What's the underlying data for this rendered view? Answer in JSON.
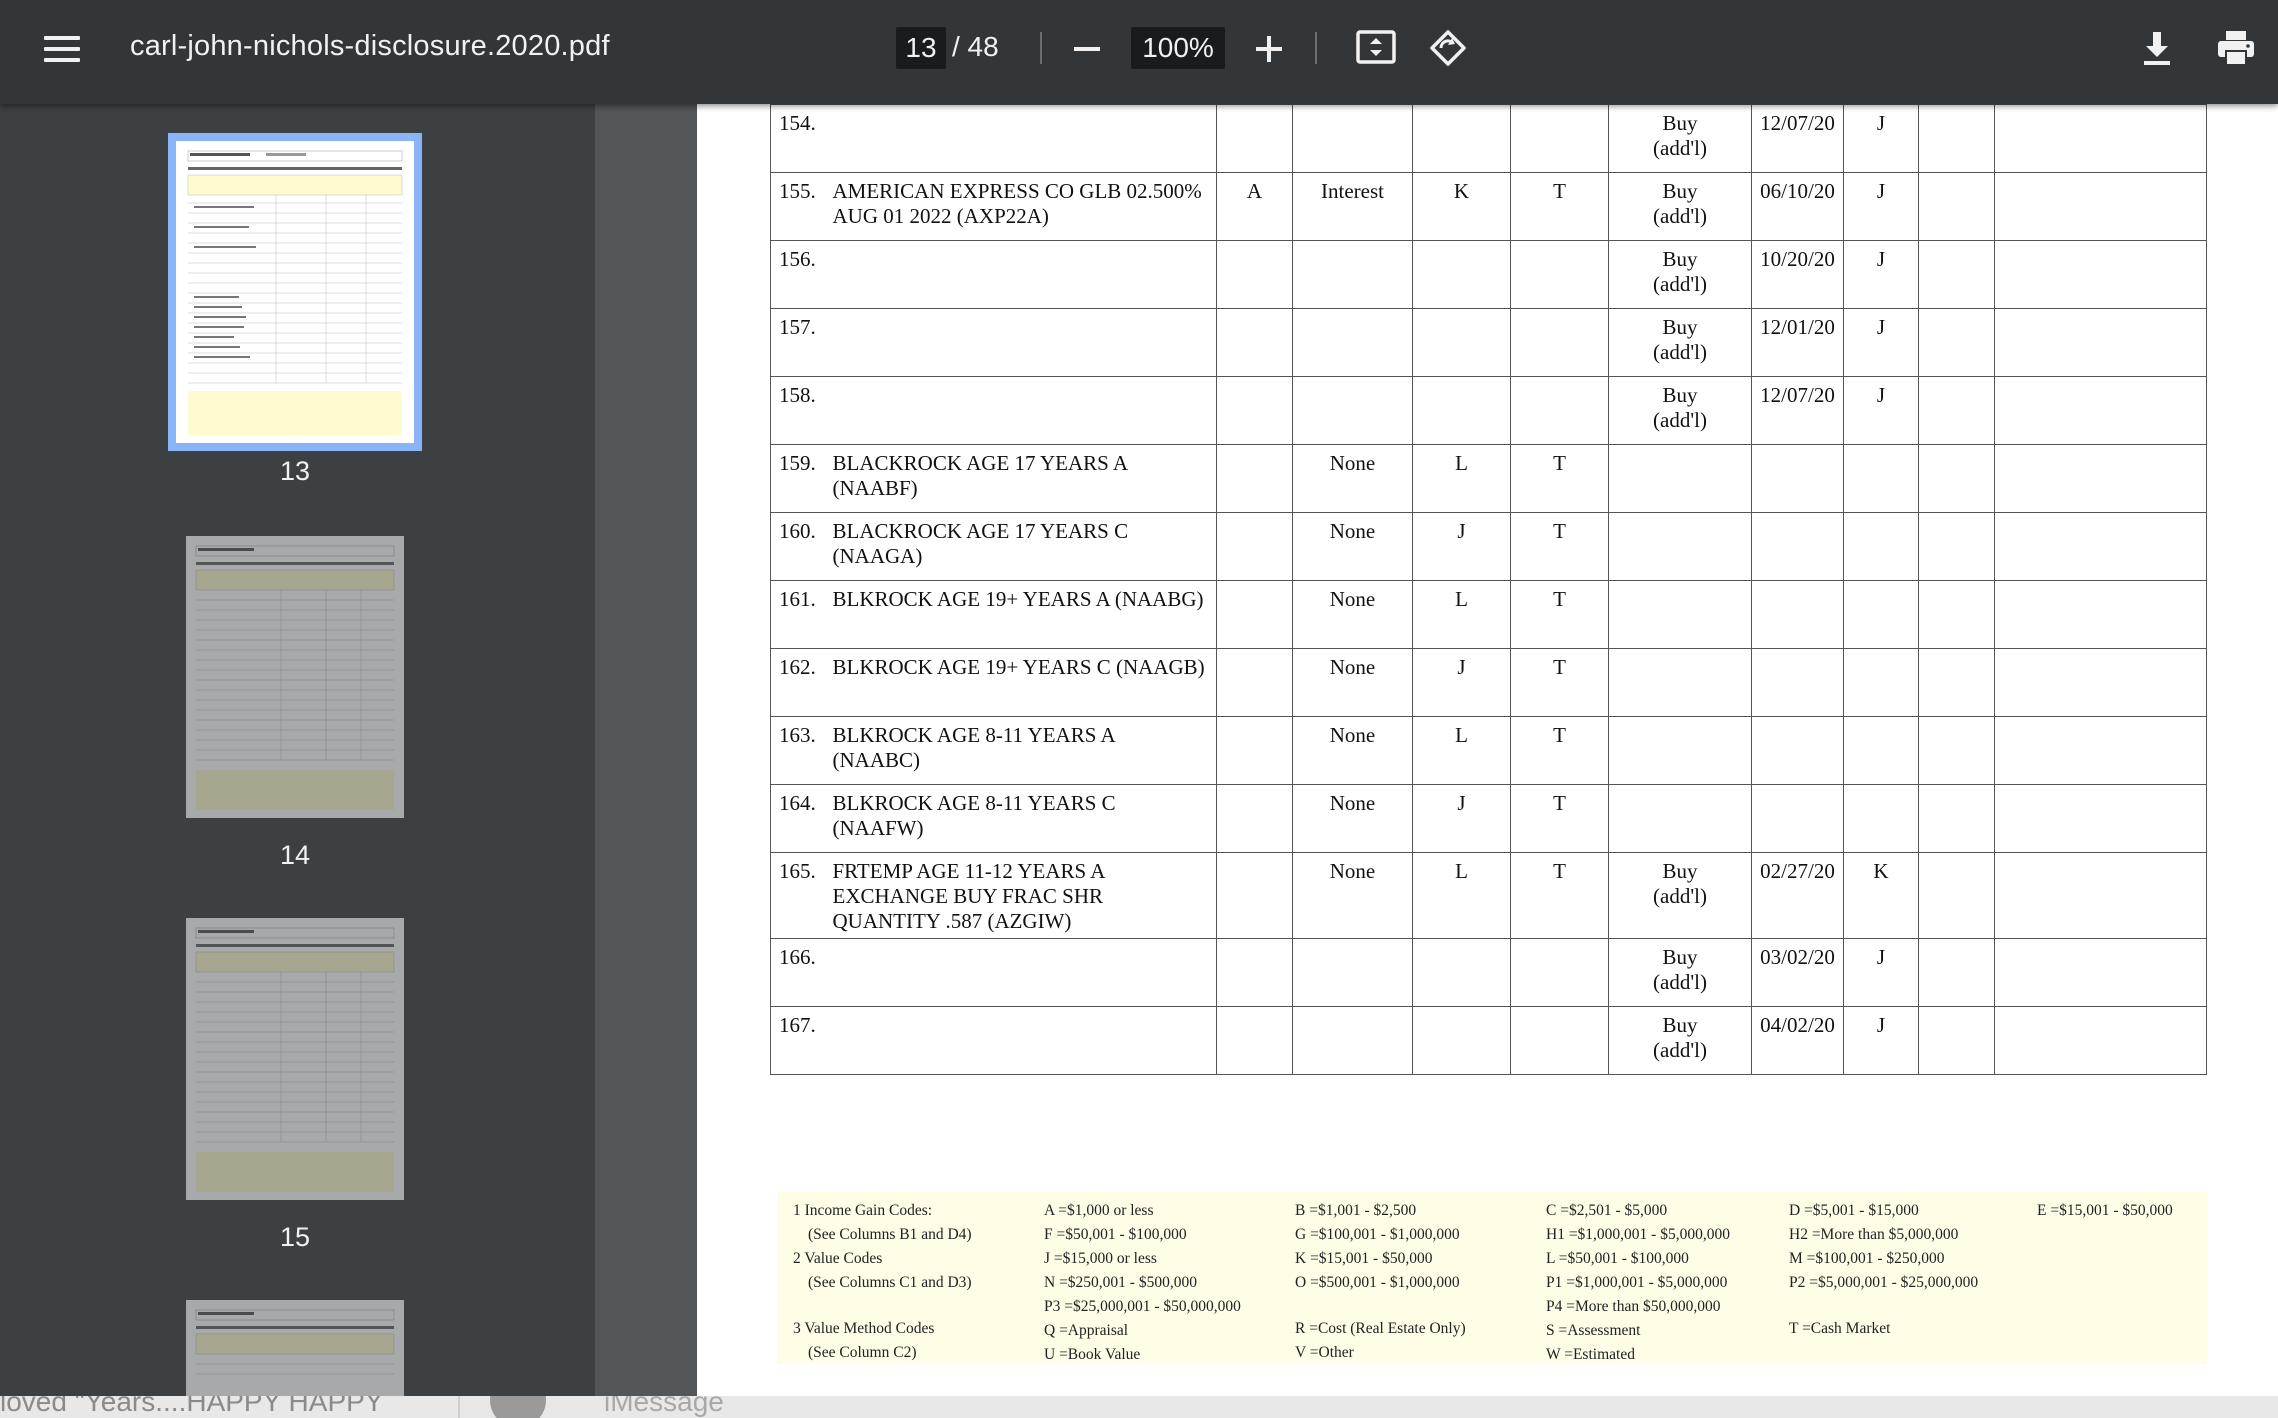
{
  "toolbar": {
    "title": "carl-john-nichols-disclosure.2020.pdf",
    "current_page": "13",
    "total_pages": "/ 48",
    "zoom": "100%"
  },
  "sidebar": {
    "thumbnails": [
      {
        "label": "13",
        "selected": true
      },
      {
        "label": "14",
        "selected": false
      },
      {
        "label": "15",
        "selected": false
      },
      {
        "label": "",
        "selected": false
      }
    ]
  },
  "table": {
    "rows": [
      {
        "num": "154.",
        "desc": "",
        "a": "",
        "b": "",
        "c1": "",
        "c2": "",
        "d1": "Buy\n(add'l)",
        "d2": "12/07/20",
        "d3": "J",
        "d4": "",
        "d5": ""
      },
      {
        "num": "155.",
        "desc": "AMERICAN EXPRESS CO GLB 02.500%\nAUG 01 2022 (AXP22A)",
        "a": "A",
        "b": "Interest",
        "c1": "K",
        "c2": "T",
        "d1": "Buy\n(add'l)",
        "d2": "06/10/20",
        "d3": "J",
        "d4": "",
        "d5": ""
      },
      {
        "num": "156.",
        "desc": "",
        "a": "",
        "b": "",
        "c1": "",
        "c2": "",
        "d1": "Buy\n(add'l)",
        "d2": "10/20/20",
        "d3": "J",
        "d4": "",
        "d5": ""
      },
      {
        "num": "157.",
        "desc": "",
        "a": "",
        "b": "",
        "c1": "",
        "c2": "",
        "d1": "Buy\n(add'l)",
        "d2": "12/01/20",
        "d3": "J",
        "d4": "",
        "d5": ""
      },
      {
        "num": "158.",
        "desc": "",
        "a": "",
        "b": "",
        "c1": "",
        "c2": "",
        "d1": "Buy\n(add'l)",
        "d2": "12/07/20",
        "d3": "J",
        "d4": "",
        "d5": ""
      },
      {
        "num": "159.",
        "desc": "BLACKROCK AGE 17 YEARS A\n(NAABF)",
        "a": "",
        "b": "None",
        "c1": "L",
        "c2": "T",
        "d1": "",
        "d2": "",
        "d3": "",
        "d4": "",
        "d5": ""
      },
      {
        "num": "160.",
        "desc": "BLACKROCK AGE 17 YEARS C\n(NAAGA)",
        "a": "",
        "b": "None",
        "c1": "J",
        "c2": "T",
        "d1": "",
        "d2": "",
        "d3": "",
        "d4": "",
        "d5": ""
      },
      {
        "num": "161.",
        "desc": "BLKROCK AGE 19+ YEARS A (NAABG)",
        "a": "",
        "b": "None",
        "c1": "L",
        "c2": "T",
        "d1": "",
        "d2": "",
        "d3": "",
        "d4": "",
        "d5": ""
      },
      {
        "num": "162.",
        "desc": "BLKROCK AGE 19+ YEARS C (NAAGB)",
        "a": "",
        "b": "None",
        "c1": "J",
        "c2": "T",
        "d1": "",
        "d2": "",
        "d3": "",
        "d4": "",
        "d5": ""
      },
      {
        "num": "163.",
        "desc": "BLKROCK AGE 8-11 YEARS A\n(NAABC)",
        "a": "",
        "b": "None",
        "c1": "L",
        "c2": "T",
        "d1": "",
        "d2": "",
        "d3": "",
        "d4": "",
        "d5": ""
      },
      {
        "num": "164.",
        "desc": "BLKROCK AGE 8-11 YEARS C\n(NAAFW)",
        "a": "",
        "b": "None",
        "c1": "J",
        "c2": "T",
        "d1": "",
        "d2": "",
        "d3": "",
        "d4": "",
        "d5": ""
      },
      {
        "num": "165.",
        "desc": "FRTEMP AGE 11-12 YEARS A\nEXCHANGE BUY FRAC SHR\nQUANTITY .587 (AZGIW)",
        "a": "",
        "b": "None",
        "c1": "L",
        "c2": "T",
        "d1": "Buy\n(add'l)",
        "d2": "02/27/20",
        "d3": "K",
        "d4": "",
        "d5": ""
      },
      {
        "num": "166.",
        "desc": "",
        "a": "",
        "b": "",
        "c1": "",
        "c2": "",
        "d1": "Buy\n(add'l)",
        "d2": "03/02/20",
        "d3": "J",
        "d4": "",
        "d5": ""
      },
      {
        "num": "167.",
        "desc": "",
        "a": "",
        "b": "",
        "c1": "",
        "c2": "",
        "d1": "Buy\n(add'l)",
        "d2": "04/02/20",
        "d3": "J",
        "d4": "",
        "d5": ""
      }
    ]
  },
  "legend": {
    "row1": [
      "1  Income Gain Codes:",
      "A =$1,000 or less",
      "B =$1,001 - $2,500",
      "C =$2,501 - $5,000",
      "D =$5,001 - $15,000",
      "E =$15,001 - $50,000"
    ],
    "row2": [
      "(See Columns B1 and D4)",
      "F =$50,001 - $100,000",
      "G =$100,001 - $1,000,000",
      "H1 =$1,000,001 - $5,000,000",
      "H2 =More than $5,000,000"
    ],
    "row3": [
      "2  Value Codes",
      "J =$15,000 or less",
      "K =$15,001 - $50,000",
      "L =$50,001 - $100,000",
      "M =$100,001 - $250,000"
    ],
    "row4": [
      "(See Columns C1 and D3)",
      "N =$250,001 - $500,000",
      "O =$500,001 - $1,000,000",
      "P1 =$1,000,001 - $5,000,000",
      "P2 =$5,000,001 - $25,000,000"
    ],
    "row5": [
      "P3 =$25,000,001 - $50,000,000",
      "P4 =More than $50,000,000"
    ],
    "row6": [
      "3  Value Method Codes",
      "Q =Appraisal",
      "R =Cost (Real Estate Only)",
      "S =Assessment",
      "T =Cash Market"
    ],
    "row7": [
      "(See Column C2)",
      "U =Book Value",
      "V =Other",
      "W =Estimated"
    ]
  },
  "bottom": {
    "text": "loved \"Years....HAPPY HAPPY",
    "message_placeholder": "iMessage"
  }
}
